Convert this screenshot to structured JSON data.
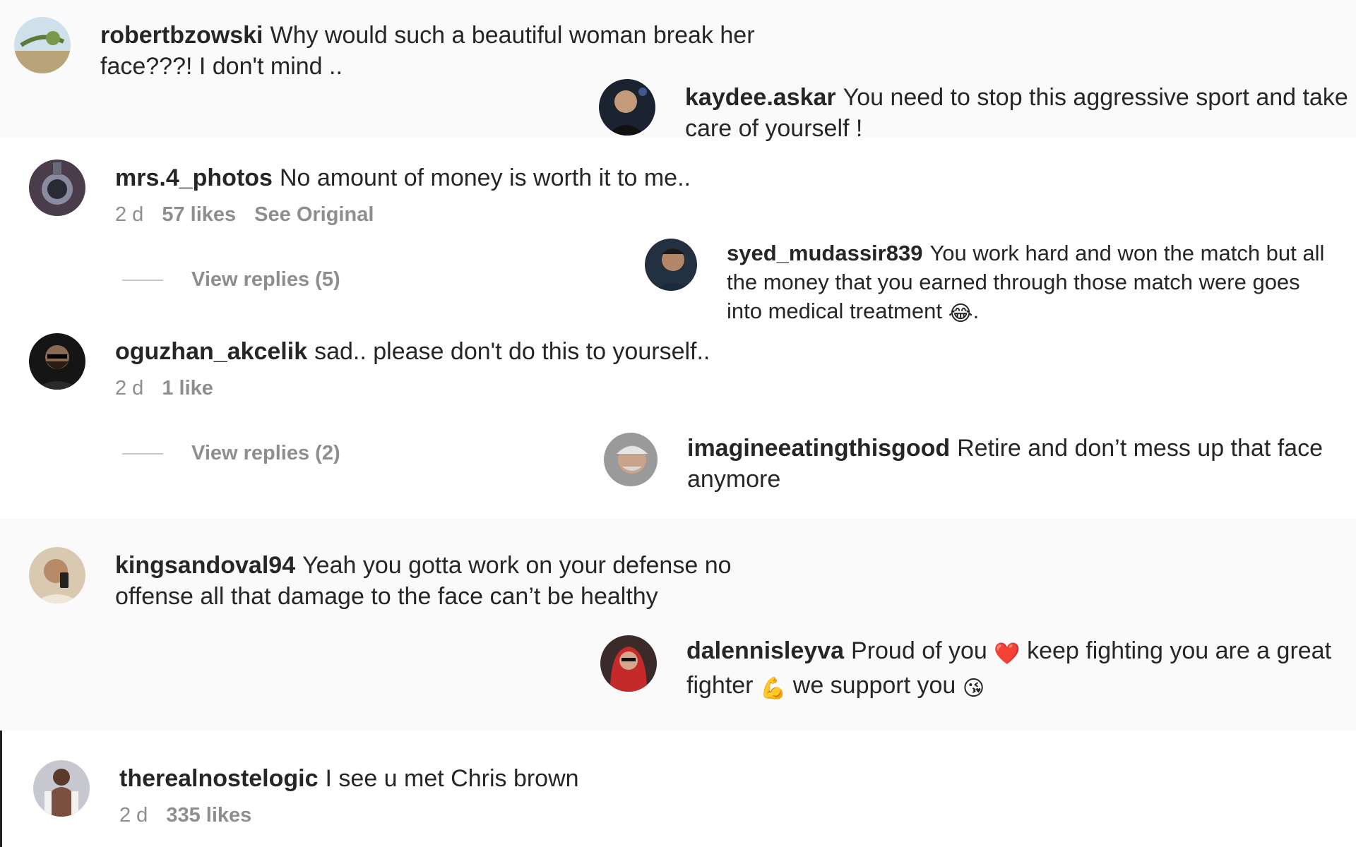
{
  "comments": [
    {
      "username": "robertbzowski",
      "text": "Why would such a beautiful woman break her",
      "text2": "face???! I don't mind .."
    },
    {
      "username": "kaydee.askar",
      "text": "You need to stop this aggressive sport and take",
      "text2": "care of yourself !"
    },
    {
      "username": "mrs.4_photos",
      "text": "No amount of money is worth it to me..",
      "time": "2 d",
      "likes": "57 likes",
      "see_original": "See Original",
      "view_replies": "View replies (5)"
    },
    {
      "username": "syed_mudassir839",
      "text": "You work hard and won the match but all",
      "text2": "the money that you earned through those match were goes",
      "text3": "into medical treatment",
      "emoji": "😂",
      "tail": "."
    },
    {
      "username": "oguzhan_akcelik",
      "text": "sad.. please don't do this to yourself..",
      "time": "2 d",
      "likes": "1 like",
      "view_replies": "View replies (2)"
    },
    {
      "username": "imagineeatingthisgood",
      "text": "Retire and don’t mess up that face",
      "text2": "anymore"
    },
    {
      "username": "kingsandoval94",
      "text": "Yeah you gotta work on your defense no",
      "text2": "offense all that damage to the face can’t be healthy"
    },
    {
      "username": "dalennisleyva",
      "text": "Proud of you",
      "emoji1": "❤️",
      "text_mid": "keep fighting you are a great",
      "text2": "fighter",
      "emoji2": "💪",
      "text2b": "we support you",
      "emoji3": "😘"
    },
    {
      "username": "therealnostelogic",
      "text": "I see u met Chris brown",
      "time": "2 d",
      "likes": "335 likes"
    }
  ],
  "icons": [
    "avatar-landscape",
    "avatar-man",
    "avatar-watch",
    "avatar-man-dark",
    "avatar-bearded",
    "avatar-grey-hair",
    "avatar-selfie",
    "avatar-red-hair",
    "avatar-shirtless"
  ]
}
